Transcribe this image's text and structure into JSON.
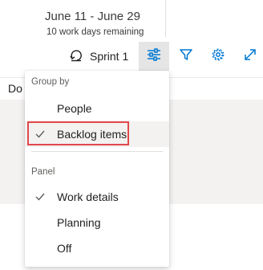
{
  "sprint_info": {
    "date_range": "June 11 - June 29",
    "remaining": "10 work days remaining"
  },
  "toolbar": {
    "sprint_label": "Sprint 1",
    "sprint_icon": "sprint-loop-icon",
    "buttons": [
      {
        "name": "view-options-icon",
        "active": true
      },
      {
        "name": "filter-icon",
        "active": false
      },
      {
        "name": "settings-gear-icon",
        "active": false
      },
      {
        "name": "expand-icon",
        "active": false
      }
    ]
  },
  "background": {
    "label_fragment": "Do"
  },
  "menu": {
    "group_by_label": "Group by",
    "group_by_items": [
      {
        "label": "People",
        "checked": false
      },
      {
        "label": "Backlog items",
        "checked": true,
        "highlighted": true
      }
    ],
    "panel_label": "Panel",
    "panel_items": [
      {
        "label": "Work details",
        "checked": true
      },
      {
        "label": "Planning",
        "checked": false
      },
      {
        "label": "Off",
        "checked": false
      }
    ]
  },
  "colors": {
    "accent": "#0078d4",
    "highlight_box": "#e0484a",
    "active_button_bg": "#e5e5e5"
  }
}
